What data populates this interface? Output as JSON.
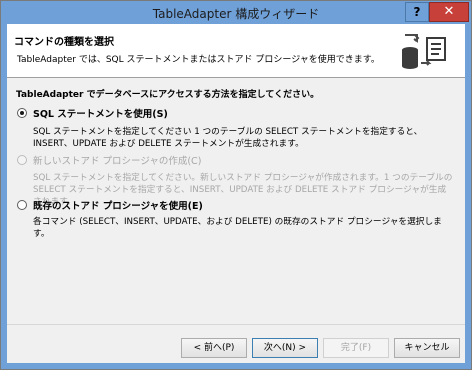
{
  "window": {
    "title": "TableAdapter 構成ウィザード",
    "help_label": "?",
    "close_label": "✕"
  },
  "header": {
    "title": "コマンドの種類を選択",
    "subtitle": "TableAdapter では、SQL ステートメントまたはストアド プロシージャを使用できます。",
    "icon": "database-to-code-icon"
  },
  "main": {
    "prompt": "TableAdapter でデータベースにアクセスする方法を指定してください。",
    "options": [
      {
        "label": "SQL ステートメントを使用(S)",
        "description": "SQL ステートメントを指定してください 1 つのテーブルの SELECT ステートメントを指定すると、INSERT、UPDATE および DELETE ステートメントが生成されます。",
        "selected": true,
        "enabled": true
      },
      {
        "label": "新しいストアド プロシージャの作成(C)",
        "description": "SQL ステートメントを指定してください。新しいストアド プロシージャが作成されます。1 つのテーブルの SELECT ステートメントを指定すると、INSERT、UPDATE および DELETE ストアド プロシージャが生成されます。",
        "selected": false,
        "enabled": false
      },
      {
        "label": "既存のストアド プロシージャを使用(E)",
        "description": "各コマンド (SELECT、INSERT、UPDATE、および DELETE) の既存のストアド プロシージャを選択します。",
        "selected": false,
        "enabled": true
      }
    ]
  },
  "footer": {
    "back_label": "< 前へ(P)",
    "next_label": "次へ(N) >",
    "finish_label": "完了(F)",
    "cancel_label": "キャンセル"
  }
}
